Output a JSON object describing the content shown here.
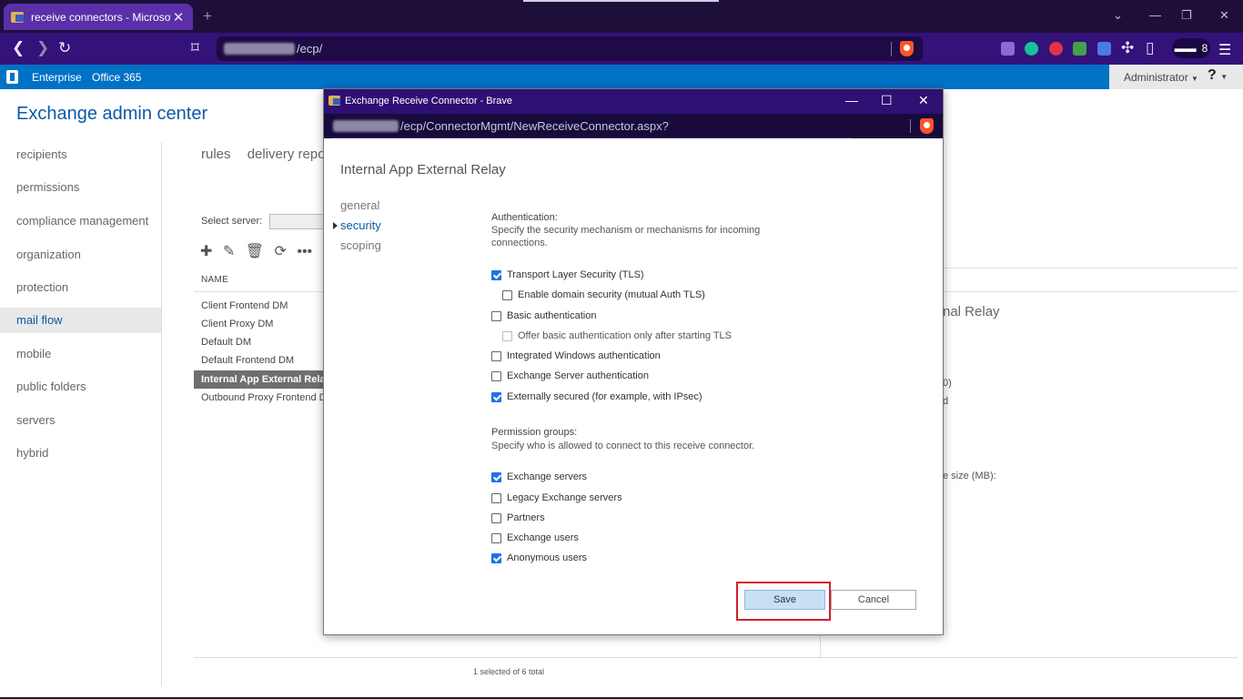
{
  "browser": {
    "tab_title": "receive connectors - Microsoft",
    "tab_close": "✕",
    "new_tab": "+",
    "url": "/ecp/",
    "ext_count": "8"
  },
  "eac": {
    "nav_links": [
      "Enterprise",
      "Office 365"
    ],
    "admin_label": "Administrator",
    "help": "?",
    "title": "Exchange admin center",
    "left_nav": [
      "recipients",
      "permissions",
      "compliance management",
      "organization",
      "protection",
      "mail flow",
      "mobile",
      "public folders",
      "servers",
      "hybrid"
    ],
    "active_nav": "mail flow",
    "subtabs": [
      "rules",
      "delivery repo"
    ],
    "select_server_label": "Select server:",
    "column_name": "NAME",
    "rows": [
      "Client Frontend DM",
      "Client Proxy DM",
      "Default DM",
      "Default Frontend DM",
      "Internal App External Relay",
      "Outbound Proxy Frontend DM"
    ],
    "selected_row": "Internal App External Relay",
    "right_title_fragment": "nal Relay",
    "right_fragments": [
      "0)",
      "d",
      "e size (MB):"
    ],
    "footer": "1 selected of 6 total"
  },
  "popup": {
    "window_title": "Exchange Receive Connector - Brave",
    "url": "/ecp/ConnectorMgmt/NewReceiveConnector.aspx?",
    "heading": "Internal App External Relay",
    "nav": [
      "general",
      "security",
      "scoping"
    ],
    "active_nav": "security",
    "auth_label": "Authentication:",
    "auth_desc": "Specify the security mechanism or mechanisms for incoming connections.",
    "auth_options": [
      {
        "label": "Transport Layer Security (TLS)",
        "checked": true,
        "indent": false,
        "disabled": false
      },
      {
        "label": "Enable domain security (mutual Auth TLS)",
        "checked": false,
        "indent": true,
        "disabled": false
      },
      {
        "label": "Basic authentication",
        "checked": false,
        "indent": false,
        "disabled": false
      },
      {
        "label": "Offer basic authentication only after starting TLS",
        "checked": false,
        "indent": true,
        "disabled": true
      },
      {
        "label": "Integrated Windows authentication",
        "checked": false,
        "indent": false,
        "disabled": false
      },
      {
        "label": "Exchange Server authentication",
        "checked": false,
        "indent": false,
        "disabled": false
      },
      {
        "label": "Externally secured (for example, with IPsec)",
        "checked": true,
        "indent": false,
        "disabled": false
      }
    ],
    "perm_label": "Permission groups:",
    "perm_desc": "Specify who is allowed to connect to this receive connector.",
    "perm_options": [
      {
        "label": "Exchange servers",
        "checked": true
      },
      {
        "label": "Legacy Exchange servers",
        "checked": false
      },
      {
        "label": "Partners",
        "checked": false
      },
      {
        "label": "Exchange users",
        "checked": false
      },
      {
        "label": "Anonymous users",
        "checked": true
      }
    ],
    "save_label": "Save",
    "cancel_label": "Cancel"
  },
  "colors": {
    "eac_blue": "#0072c6",
    "accent_link": "#0a5aa7",
    "highlight_red": "#d21f2b",
    "browser_purple": "#33127a"
  }
}
